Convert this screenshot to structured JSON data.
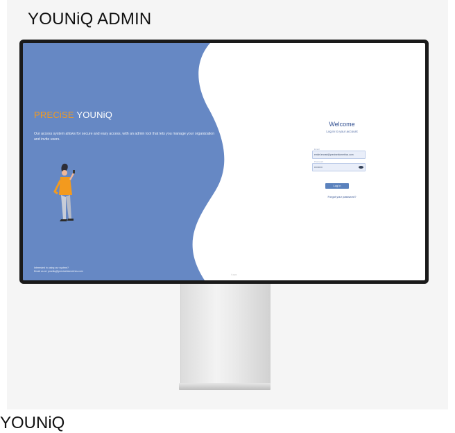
{
  "page": {
    "title": "YOUNiQ ADMIN",
    "bottom_text": "YOUNiQ"
  },
  "brand": {
    "accent_part": "PRECiSE",
    "name_part": " YOUNiQ",
    "accent_color": "#f39a1e"
  },
  "intro": {
    "text": "Our access system allows for secure and easy access, with an admin tool that lets you manage your organization and invite users."
  },
  "contact": {
    "line1": "Interested in using our system?",
    "line2": "Email us at: younitq@precisebiometrics.com"
  },
  "login": {
    "heading": "Welcome",
    "subheading": "Log in to your account",
    "email_label": "Email",
    "email_value": "emile.lennart@precisebiometrics.com",
    "password_label": "Password",
    "password_value": "••••••••••",
    "submit_label": "Log in",
    "forgot_label": "Forgot your password?"
  },
  "screen_footer": "© 2023",
  "colors": {
    "left_panel": "#6688c4",
    "primary_button": "#5b82bd",
    "monitor_bezel": "#1a1a1a"
  }
}
